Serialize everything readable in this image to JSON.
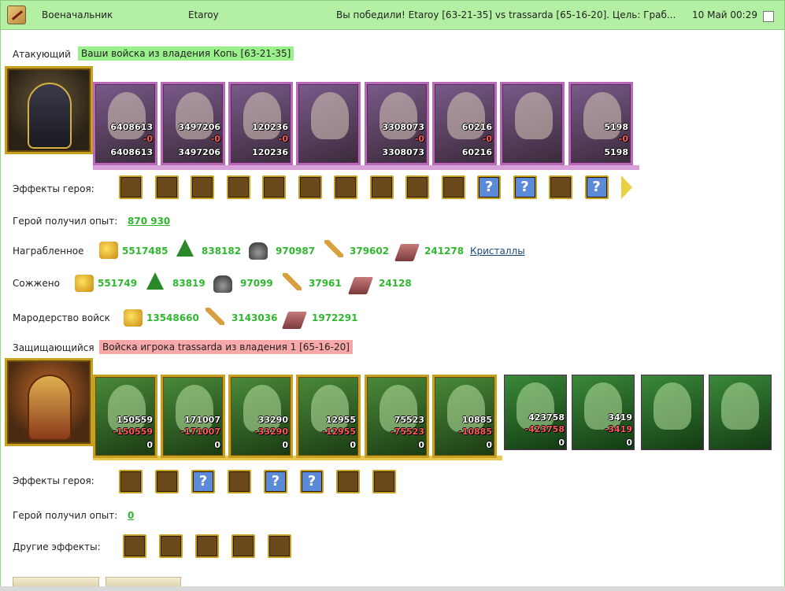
{
  "topbar": {
    "role": "Военачальник",
    "player": "Etaroy",
    "summary": "Вы победили! Etaroy [63-21-35] vs trassarda [65-16-20]. Цель: Граб...",
    "date": "10 Май 00:29"
  },
  "attacker": {
    "label": "Атакующий",
    "banner": "Ваши войска из владения Копь [63-21-35]",
    "units": [
      {
        "top": "6408613",
        "loss": "-0",
        "bottom": "6408613"
      },
      {
        "top": "3497206",
        "loss": "-0",
        "bottom": "3497206"
      },
      {
        "top": "120236",
        "loss": "-0",
        "bottom": "120236"
      },
      {
        "top": "",
        "loss": "",
        "bottom": ""
      },
      {
        "top": "3308073",
        "loss": "-0",
        "bottom": "3308073"
      },
      {
        "top": "60216",
        "loss": "-0",
        "bottom": "60216"
      },
      {
        "top": "",
        "loss": "",
        "bottom": ""
      },
      {
        "top": "5198",
        "loss": "-0",
        "bottom": "5198"
      }
    ],
    "effects_label": "Эффекты героя:",
    "effects": [
      "tower-icon",
      "dice-icon",
      "shield-icon",
      "handshake-icon",
      "sword-icon",
      "handshake-icon",
      "hand-icon",
      "cart-icon",
      "fire-coin-icon",
      "skull-coin-icon",
      "question-icon",
      "question-icon",
      "knight-icon",
      "question-icon"
    ],
    "exp_label": "Герой получил опыт:",
    "exp_value": "870 930",
    "loot_label": "Награбленное",
    "loot": [
      "5517485",
      "838182",
      "970987",
      "379602",
      "241278"
    ],
    "crystals": "Кристаллы",
    "burned_label": "Сожжено",
    "burned": [
      "551749",
      "83819",
      "97099",
      "37961",
      "24128"
    ],
    "marauding_label": "Мародерство войск",
    "marauding": [
      "13548660",
      "3143036",
      "1972291"
    ]
  },
  "defender": {
    "label": "Защищающийся",
    "banner": "Войска игрока trassarda из владения 1 [65-16-20]",
    "units": [
      {
        "top": "150559",
        "loss": "-150559",
        "bottom": "0"
      },
      {
        "top": "171007",
        "loss": "-171007",
        "bottom": "0"
      },
      {
        "top": "33290",
        "loss": "-33290",
        "bottom": "0"
      },
      {
        "top": "12955",
        "loss": "-12955",
        "bottom": "0"
      },
      {
        "top": "75523",
        "loss": "-75523",
        "bottom": "0"
      },
      {
        "top": "10885",
        "loss": "-10885",
        "bottom": "0"
      },
      {
        "top": "423758",
        "loss": "-423758",
        "bottom": "0"
      },
      {
        "top": "3419",
        "loss": "-3419",
        "bottom": "0"
      },
      {
        "top": "",
        "loss": "",
        "bottom": ""
      },
      {
        "top": "",
        "loss": "",
        "bottom": ""
      }
    ],
    "effects_label": "Эффекты героя:",
    "effects": [
      "tower-icon",
      "shield-icon",
      "question-icon",
      "rabbit-icon",
      "question-icon",
      "question-icon",
      "sword-icon",
      "armor-icon"
    ],
    "exp_label": "Герой получил опыт:",
    "exp_value": "0",
    "other_label": "Другие эффекты:",
    "other_effects": [
      "heart-sword-icon",
      "sword-icon",
      "heart-sword-icon",
      "sword-green-icon",
      "sword-fire-icon"
    ]
  },
  "colors": {
    "topbar": "#b4f0a4",
    "value_green": "#2fb82f",
    "attacker_banner": "#9af08a",
    "defender_banner": "#f7a8a8"
  }
}
